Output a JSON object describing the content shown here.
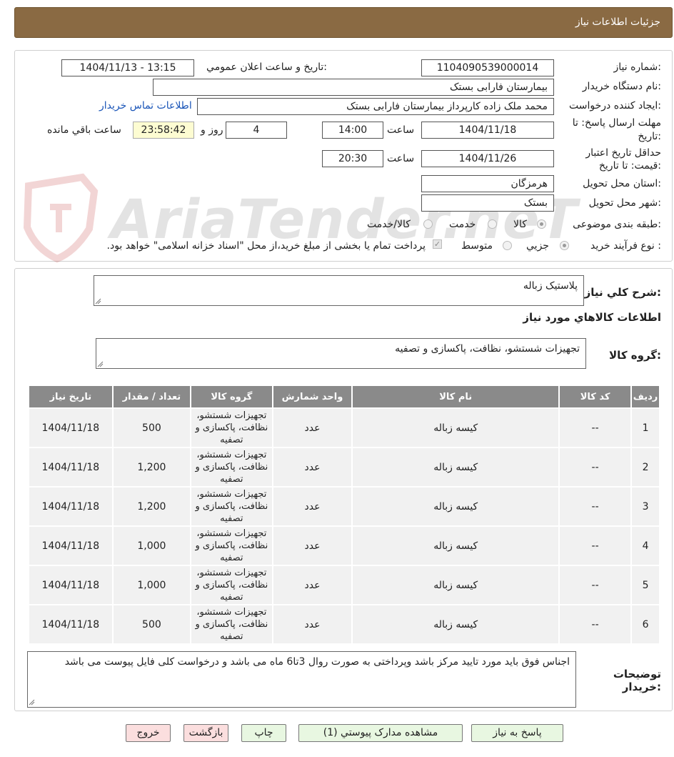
{
  "header": {
    "title": "جزئیات اطلاعات نیاز"
  },
  "form": {
    "need_number_label": "شماره نیاز:",
    "need_number": "1104090539000014",
    "announce_label": "تاریخ و ساعت اعلان عمومي:",
    "announce_value": "1404/11/13 - 13:15",
    "buyer_org_label": "نام دستگاه خریدار:",
    "buyer_org": "بیمارستان فارابی بستک",
    "requester_label": "ایجاد کننده درخواست:",
    "requester": "محمد ملک زاده کارپرداز بیمارستان فارابی بستک",
    "contact_link": "اطلاعات تماس خریدار",
    "deadline_label_1": "مهلت ارسال پاسخ: تا",
    "deadline_label_2": "تاریخ:",
    "deadline_date": "1404/11/18",
    "time_label": "ساعت",
    "deadline_time": "14:00",
    "days_value": "4",
    "days_label": "روز و",
    "remaining_time": "23:58:42",
    "remaining_label": "ساعت باقي مانده",
    "validity_label_1": "حداقل تاریخ اعتبار",
    "validity_label_2": "قیمت: تا تاریخ:",
    "validity_date": "1404/11/26",
    "validity_time": "20:30",
    "province_label": "استان محل تحویل:",
    "province": "هرمزگان",
    "city_label": "شهر محل تحویل:",
    "city": "بستک",
    "category_label": "طبقه بندی موضوعی:",
    "category_options": [
      "کالا",
      "خدمت",
      "کالا/خدمت"
    ],
    "category_selected": "کالا",
    "process_label": "نوع فرآیند خرید :",
    "process_options": [
      "جزیي",
      "متوسط"
    ],
    "process_selected": "جزیي",
    "payment_note": "پرداخت تمام یا بخشی از مبلغ خرید،از محل \"اسناد خزانه اسلامی\" خواهد بود."
  },
  "watermark": {
    "text": "AriaTender.neT"
  },
  "details": {
    "summary_label": "شرح کلي نیاز:",
    "summary_value": "پلاستیک زباله",
    "goods_info_title": "اطلاعات کالاهاي مورد نیاز",
    "goods_group_label": "گروه کالا:",
    "goods_group_value": "تجهیزات شستشو، نظافت، پاکسازی و تصفیه",
    "table": {
      "headers": [
        "ردیف",
        "کد کالا",
        "نام کالا",
        "واحد شمارش",
        "گروه کالا",
        "تعداد / مقدار",
        "تاریخ نیاز"
      ],
      "rows": [
        [
          "1",
          "--",
          "کیسه زباله",
          "عدد",
          "تجهیزات شستشو، نظافت، پاکسازی و تصفیه",
          "500",
          "1404/11/18"
        ],
        [
          "2",
          "--",
          "کیسه زباله",
          "عدد",
          "تجهیزات شستشو، نظافت، پاکسازی و تصفیه",
          "1,200",
          "1404/11/18"
        ],
        [
          "3",
          "--",
          "کیسه زباله",
          "عدد",
          "تجهیزات شستشو، نظافت، پاکسازی و تصفیه",
          "1,200",
          "1404/11/18"
        ],
        [
          "4",
          "--",
          "کیسه زباله",
          "عدد",
          "تجهیزات شستشو، نظافت، پاکسازی و تصفیه",
          "1,000",
          "1404/11/18"
        ],
        [
          "5",
          "--",
          "کیسه زباله",
          "عدد",
          "تجهیزات شستشو، نظافت، پاکسازی و تصفیه",
          "1,000",
          "1404/11/18"
        ],
        [
          "6",
          "--",
          "کیسه زباله",
          "عدد",
          "تجهیزات شستشو، نظافت، پاکسازی و تصفیه",
          "500",
          "1404/11/18"
        ]
      ]
    },
    "buyer_notes_label_1": "توضیحات",
    "buyer_notes_label_2": "خریدار:",
    "buyer_notes_value": "اجناس فوق باید مورد تایید مرکز باشد وپرداختی به صورت روال 3تا6 ماه می باشد و درخواست کلی فایل پیوست می باشد"
  },
  "buttons": {
    "reply": "پاسخ به نیاز",
    "attachments": "مشاهده مدارک پیوستي (1)",
    "print": "چاپ",
    "back": "بازگشت",
    "exit": "خروج"
  },
  "colors": {
    "header_bg": "#8a6a43",
    "table_header_bg": "#8a8a8a",
    "row_bg": "#f1f1f1",
    "button_green": "#e8f7e1",
    "button_pink": "#fbdede",
    "link": "#1a55b8",
    "remaining_bg": "#fdfcd2"
  }
}
